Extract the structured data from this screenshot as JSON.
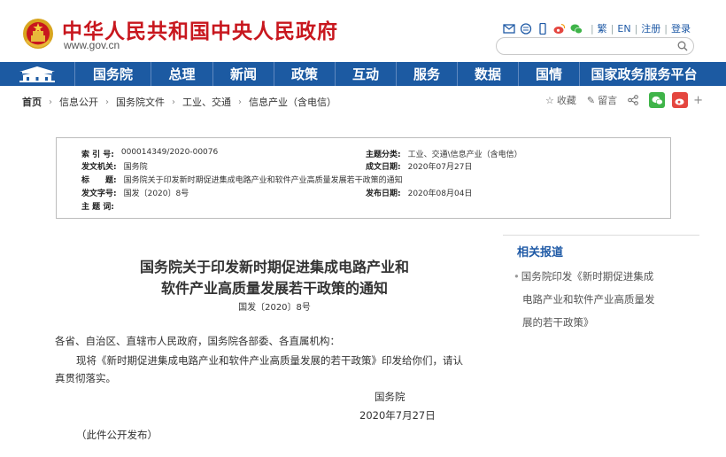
{
  "header": {
    "site_title": "中华人民共和国中央人民政府",
    "site_url": "www.gov.cn",
    "top_links": [
      "繁",
      "EN",
      "注册",
      "登录"
    ],
    "search_placeholder": ""
  },
  "nav": {
    "items": [
      "国务院",
      "总理",
      "新闻",
      "政策",
      "互动",
      "服务",
      "数据",
      "国情",
      "国家政务服务平台"
    ]
  },
  "breadcrumb": [
    "首页",
    "信息公开",
    "国务院文件",
    "工业、交通",
    "信息产业（含电信）"
  ],
  "share": {
    "favorite": "收藏",
    "comment": "留言"
  },
  "meta": {
    "index_no_label": "索 引 号:",
    "index_no": "000014349/2020-00076",
    "topic_label": "主题分类:",
    "topic": "工业、交通\\信息产业（含电信）",
    "issuer_label": "发文机关:",
    "issuer": "国务院",
    "written_date_label": "成文日期:",
    "written_date": "2020年07月27日",
    "title_label": "标　　题:",
    "title": "国务院关于印发新时期促进集成电路产业和软件产业高质量发展若干政策的通知",
    "doc_no_label": "发文字号:",
    "doc_no": "国发〔2020〕8号",
    "publish_date_label": "发布日期:",
    "publish_date": "2020年08月04日",
    "keywords_label": "主 题 词:",
    "keywords": ""
  },
  "article": {
    "title_line1": "国务院关于印发新时期促进集成电路产业和",
    "title_line2": "软件产业高质量发展若干政策的通知",
    "doc_no": "国发〔2020〕8号",
    "salutation": "各省、自治区、直辖市人民政府，国务院各部委、各直属机构：",
    "body_line1": "现将《新时期促进集成电路产业和软件产业高质量发展的若干政策》印发给你们，请认",
    "body_line2": "真贯彻落实。",
    "signer": "国务院",
    "sign_date": "2020年7月27日",
    "publicity_note": "（此件公开发布）"
  },
  "related": {
    "heading": "相关报道",
    "items": [
      {
        "line1": "国务院印发《新时期促进集成",
        "line2": "电路产业和软件产业高质量发",
        "line3": "展的若干政策》"
      }
    ]
  },
  "colors": {
    "brand_red": "#c8171e",
    "nav_blue": "#1c5aa2",
    "link_blue": "#1f5aa6"
  }
}
